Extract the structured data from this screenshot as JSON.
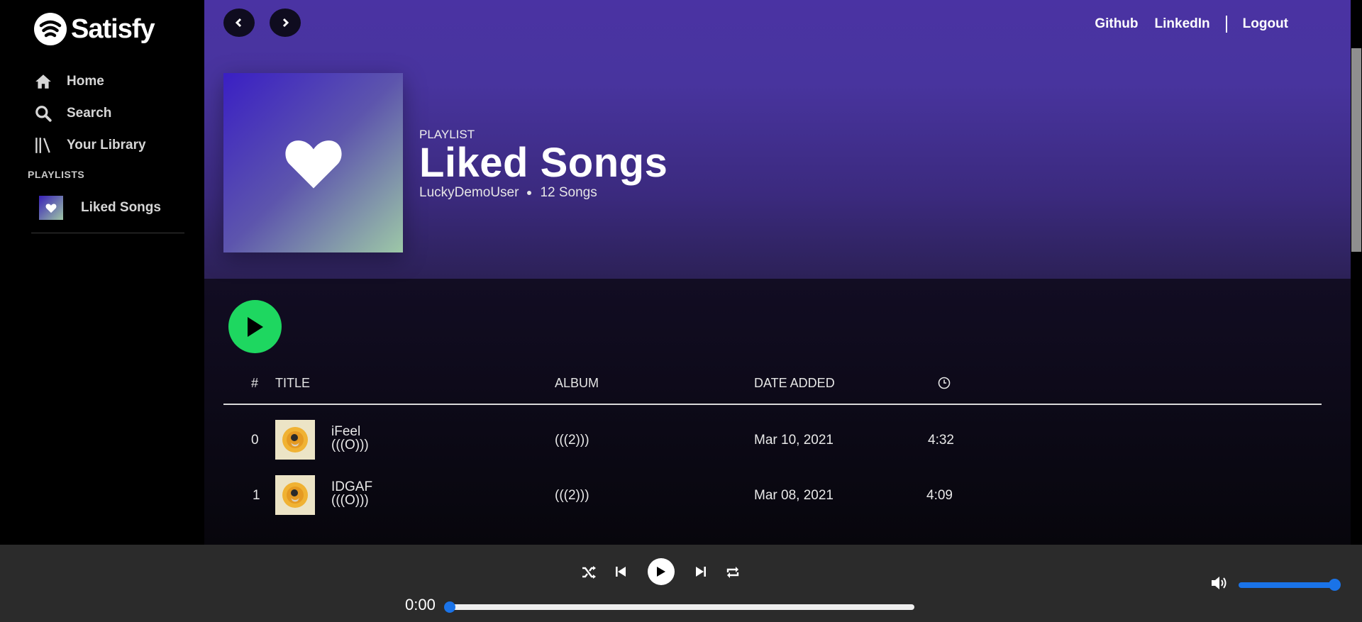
{
  "app": {
    "name": "Satisfy"
  },
  "sidebar": {
    "nav": [
      {
        "label": "Home",
        "icon": "home-icon"
      },
      {
        "label": "Search",
        "icon": "search-icon"
      },
      {
        "label": "Your Library",
        "icon": "library-icon"
      }
    ],
    "playlists_heading": "PLAYLISTS",
    "playlists": [
      {
        "label": "Liked Songs",
        "icon": "heart-icon"
      }
    ]
  },
  "header": {
    "links": [
      "Github",
      "LinkedIn",
      "Logout"
    ]
  },
  "playlist": {
    "type": "PLAYLIST",
    "title": "Liked Songs",
    "owner": "LuckyDemoUser",
    "count": "12 Songs"
  },
  "table": {
    "columns": {
      "num": "#",
      "title": "TITLE",
      "album": "ALBUM",
      "date": "DATE ADDED",
      "duration_icon": "clock-icon"
    },
    "rows": [
      {
        "num": "0",
        "title": "iFeel",
        "artist": "(((O)))",
        "album": "(((2)))",
        "date": "Mar 10, 2021",
        "duration": "4:32"
      },
      {
        "num": "1",
        "title": "IDGAF",
        "artist": "(((O)))",
        "album": "(((2)))",
        "date": "Mar 08, 2021",
        "duration": "4:09"
      }
    ]
  },
  "player": {
    "time": "0:00",
    "progress": 0.0,
    "volume": 1.0
  },
  "colors": {
    "accent_green": "#1ed760",
    "hero_purple": "#4a33a3",
    "slider_blue": "#1a73e8"
  }
}
